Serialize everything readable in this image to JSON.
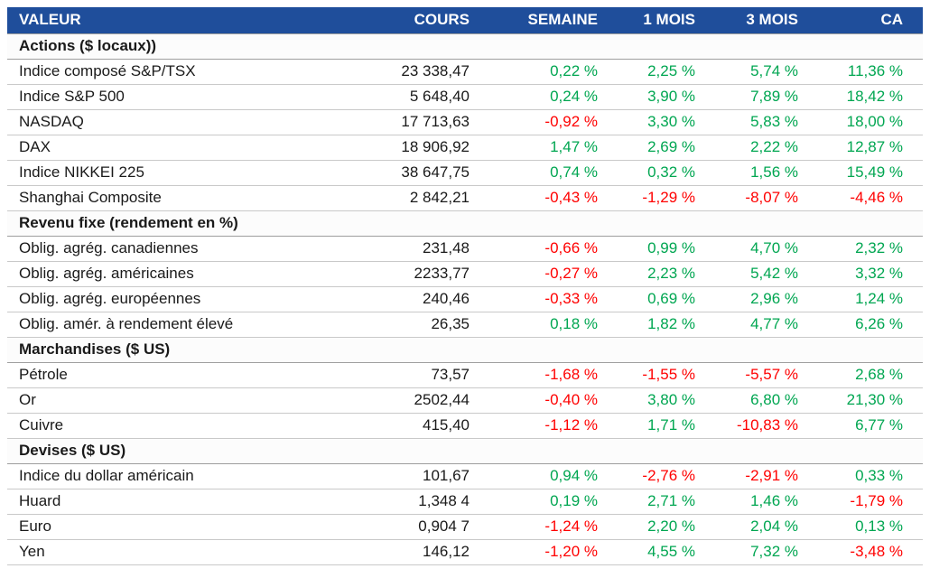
{
  "colors": {
    "header_bg": "#1F4E9B",
    "header_text": "#FFFFFF",
    "positive_green": "#00A651",
    "negative_red": "#FF0000",
    "row_border_gray": "#C9C9C9",
    "section_border_gray": "#9E9E9E"
  },
  "chart_data": {
    "type": "table",
    "columns": [
      "VALEUR",
      "COURS",
      "SEMAINE",
      "1 MOIS",
      "3 MOIS",
      "CA"
    ],
    "sections": [
      {
        "title": "Actions ($ locaux))",
        "rows": [
          [
            "Indice composé S&P/TSX",
            "23 338,47",
            "0,22 %",
            "2,25 %",
            "5,74 %",
            "11,36 %"
          ],
          [
            "Indice S&P 500",
            "5 648,40",
            "0,24 %",
            "3,90 %",
            "7,89 %",
            "18,42 %"
          ],
          [
            "NASDAQ",
            "17 713,63",
            "-0,92 %",
            "3,30 %",
            "5,83 %",
            "18,00 %"
          ],
          [
            "DAX",
            "18 906,92",
            "1,47 %",
            "2,69 %",
            "2,22 %",
            "12,87 %"
          ],
          [
            "Indice NIKKEI 225",
            "38 647,75",
            "0,74 %",
            "0,32 %",
            "1,56 %",
            "15,49 %"
          ],
          [
            "Shanghai Composite",
            "2 842,21",
            "-0,43 %",
            "-1,29 %",
            "-8,07 %",
            "-4,46 %"
          ]
        ]
      },
      {
        "title": "Revenu fixe (rendement en %)",
        "rows": [
          [
            "Oblig. agrég. canadiennes",
            "231,48",
            "-0,66 %",
            "0,99 %",
            "4,70 %",
            "2,32 %"
          ],
          [
            "Oblig. agrég. américaines",
            "2233,77",
            "-0,27 %",
            "2,23 %",
            "5,42 %",
            "3,32 %"
          ],
          [
            "Oblig. agrég. européennes",
            "240,46",
            "-0,33 %",
            "0,69 %",
            "2,96 %",
            "1,24 %"
          ],
          [
            "Oblig. amér. à rendement élevé",
            "26,35",
            "0,18 %",
            "1,82 %",
            "4,77 %",
            "6,26 %"
          ]
        ]
      },
      {
        "title": "Marchandises ($ US)",
        "rows": [
          [
            "Pétrole",
            "73,57",
            "-1,68 %",
            "-1,55 %",
            "-5,57 %",
            "2,68 %"
          ],
          [
            "Or",
            "2502,44",
            "-0,40 %",
            "3,80 %",
            "6,80 %",
            "21,30 %"
          ],
          [
            "Cuivre",
            "415,40",
            "-1,12 %",
            "1,71 %",
            "-10,83 %",
            "6,77 %"
          ]
        ]
      },
      {
        "title": "Devises ($ US)",
        "rows": [
          [
            "Indice du dollar américain",
            "101,67",
            "0,94 %",
            "-2,76 %",
            "-2,91 %",
            "0,33 %"
          ],
          [
            "Huard",
            "1,348 4",
            "0,19 %",
            "2,71 %",
            "1,46 %",
            "-1,79 %"
          ],
          [
            "Euro",
            "0,904 7",
            "-1,24 %",
            "2,20 %",
            "2,04 %",
            "0,13 %"
          ],
          [
            "Yen",
            "146,12",
            "-1,20 %",
            "4,55 %",
            "7,32 %",
            "-3,48 %"
          ]
        ]
      }
    ]
  }
}
